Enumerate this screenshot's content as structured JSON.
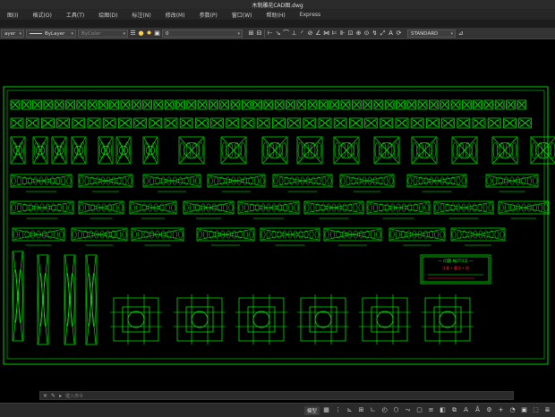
{
  "window": {
    "title": "木制雕花CAD图.dwg"
  },
  "menu": {
    "items": [
      {
        "label": "图(I)"
      },
      {
        "label": "格式(O)"
      },
      {
        "label": "工具(T)"
      },
      {
        "label": "绘图(D)"
      },
      {
        "label": "标注(N)"
      },
      {
        "label": "修改(M)"
      },
      {
        "label": "参数(P)"
      },
      {
        "label": "窗口(W)"
      },
      {
        "label": "帮助(H)"
      },
      {
        "label": "Express"
      }
    ]
  },
  "toolbar": {
    "layer_combo": "ayer",
    "linetype_combo": "ByLayer",
    "color_combo": "ByColor",
    "layer_state": "0",
    "text_style": "STANDARD"
  },
  "drawing": {
    "panel_title": "一 问题 NOTICE 一",
    "panel_subtitle": "注意 • 重点 • 如",
    "line_color": "#00ff00",
    "highlight_color": "#ff2a2a"
  },
  "commandline": {
    "placeholder": "键入命令"
  },
  "statusbar": {
    "model_label": "模型"
  }
}
